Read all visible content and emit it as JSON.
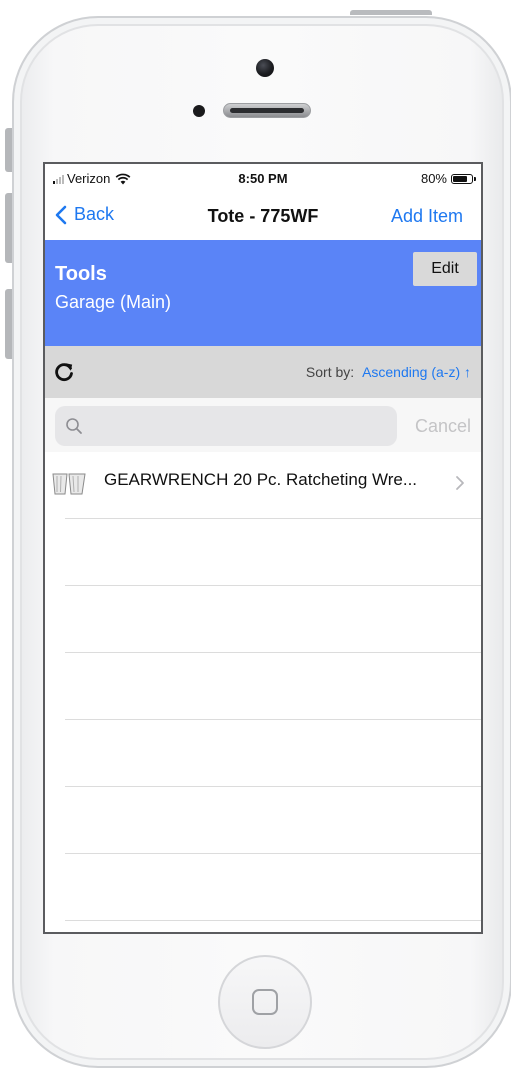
{
  "status_bar": {
    "carrier": "Verizon",
    "time": "8:50 PM",
    "battery": "80%"
  },
  "nav": {
    "back_label": "Back",
    "title": "Tote - 775WF",
    "add_label": "Add Item"
  },
  "header": {
    "title": "Tools",
    "subtitle": "Garage (Main)",
    "edit_label": "Edit"
  },
  "sort": {
    "label": "Sort by:",
    "value": "Ascending (a-z) ↑"
  },
  "search": {
    "placeholder": "",
    "cancel_label": "Cancel"
  },
  "items": [
    {
      "label": "GEARWRENCH 20 Pc. Ratcheting Wre...",
      "icon": "wrench-set-icon"
    }
  ],
  "colors": {
    "accent": "#1e78f0",
    "header_band": "#5a84f7",
    "sort_bar": "#d8d8d8"
  }
}
